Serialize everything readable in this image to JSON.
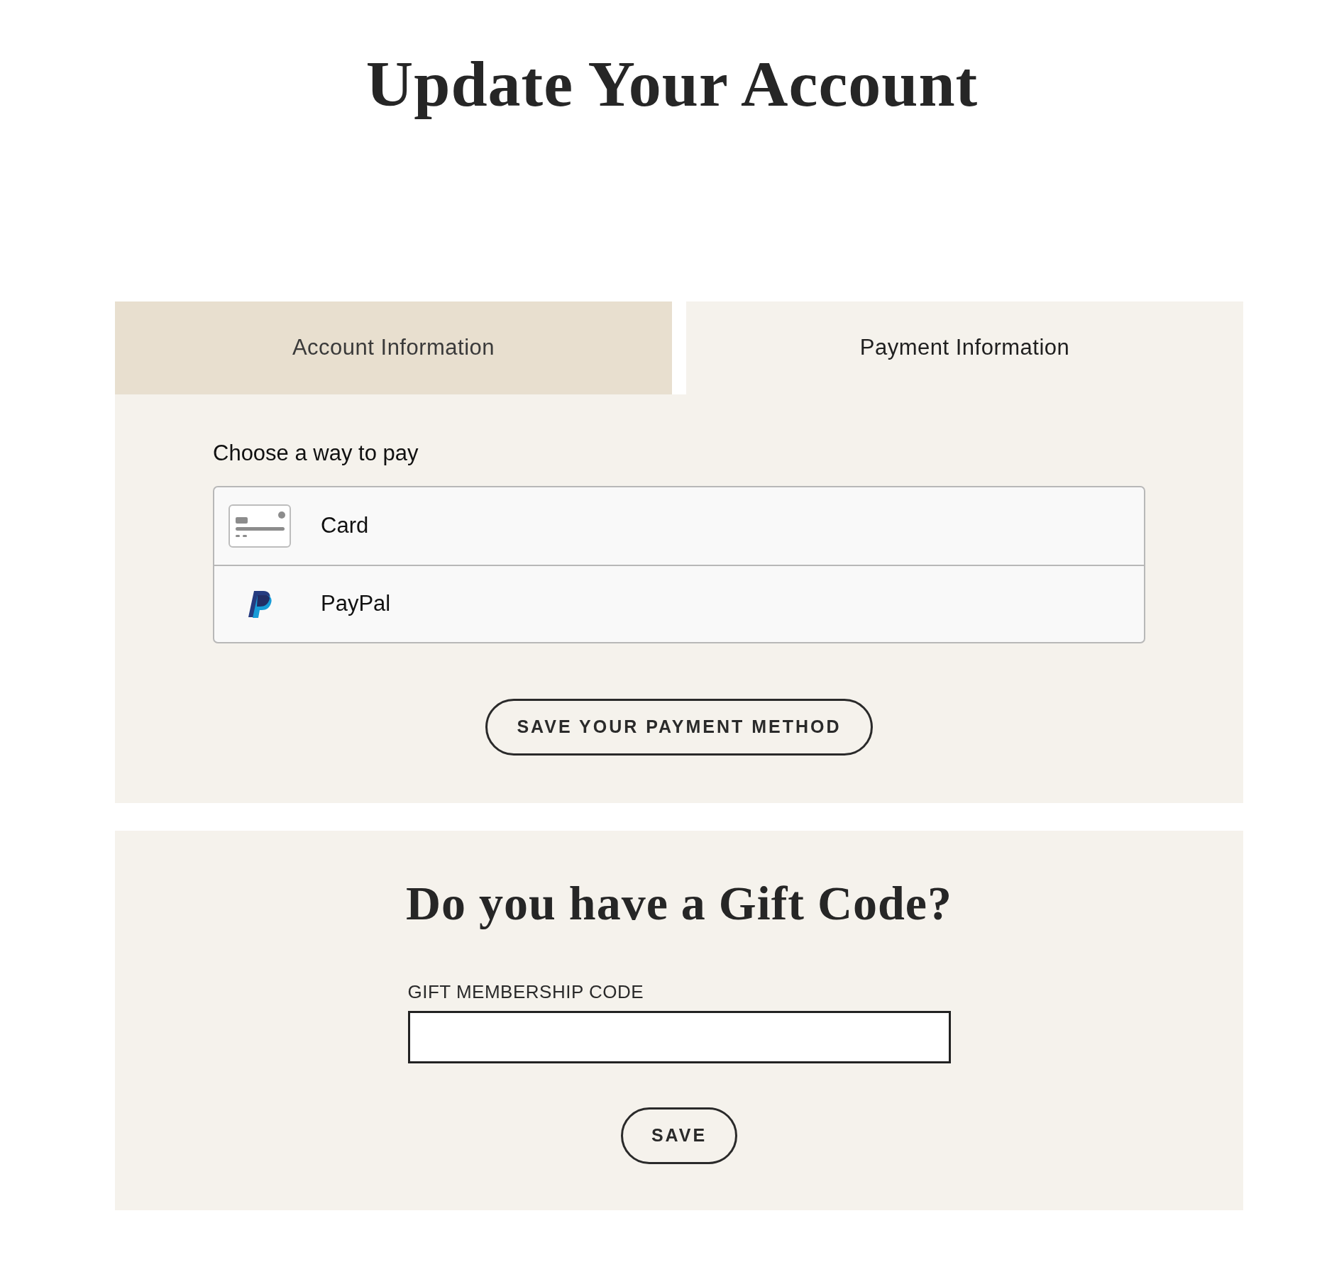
{
  "page": {
    "title": "Update Your Account"
  },
  "tabs": [
    {
      "label": "Account Information",
      "selected": false
    },
    {
      "label": "Payment Information",
      "selected": true
    }
  ],
  "payment": {
    "heading": "Choose a way to pay",
    "methods": [
      {
        "kind": "card",
        "label": "Card"
      },
      {
        "kind": "paypal",
        "label": "PayPal"
      }
    ],
    "button": "SAVE YOUR PAYMENT METHOD"
  },
  "gift": {
    "heading": "Do you have a Gift Code?",
    "field_label": "GIFT MEMBERSHIP CODE",
    "button": "SAVE"
  }
}
